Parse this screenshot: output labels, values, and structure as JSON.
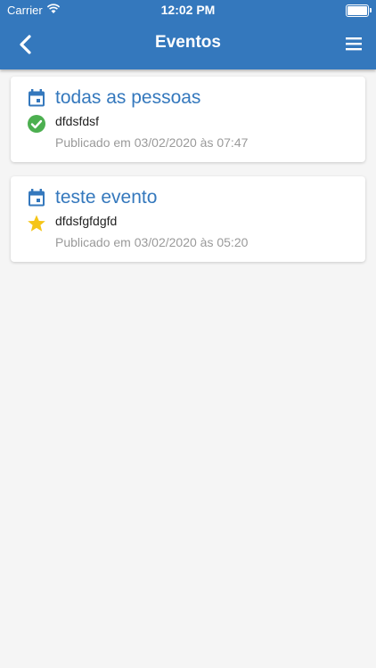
{
  "status_bar": {
    "carrier": "Carrier",
    "time": "12:02 PM"
  },
  "header": {
    "title": "Eventos",
    "back_icon": "chevron-left-icon",
    "menu_icon": "hamburger-menu-icon",
    "color": "#3478bd"
  },
  "events": [
    {
      "title": "todas as pessoas",
      "description": "dfdsfdsf",
      "published": "Publicado em 03/02/2020 às 07:47",
      "status_icon": "check-circle-icon",
      "status_color": "#4caf50"
    },
    {
      "title": "teste evento",
      "description": "dfdsfgfdgfd",
      "published": "Publicado em 03/02/2020 às 05:20",
      "status_icon": "star-icon",
      "status_color": "#f5c518"
    }
  ],
  "accent_color": "#3478bd"
}
